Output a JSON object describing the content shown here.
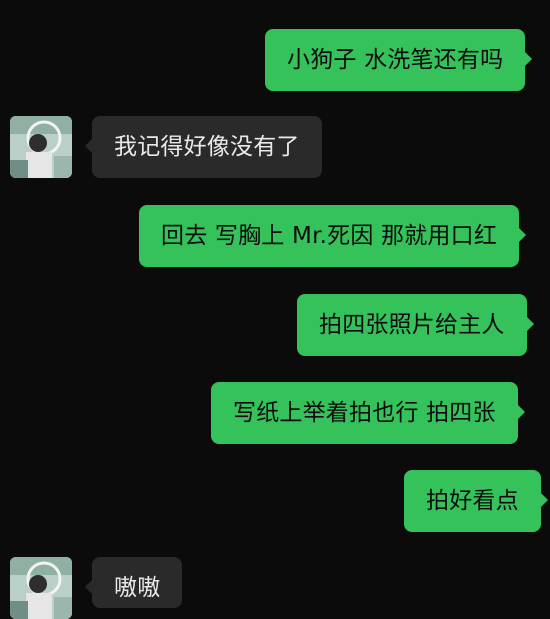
{
  "messages": [
    {
      "sender": "self",
      "text": "小狗子 水洗笔还有吗"
    },
    {
      "sender": "other",
      "text": "我记得好像没有了"
    },
    {
      "sender": "self",
      "text": "回去 写胸上 Mr.死因 那就用口红"
    },
    {
      "sender": "self",
      "text": "拍四张照片给主人"
    },
    {
      "sender": "self",
      "text": "写纸上举着拍也行 拍四张"
    },
    {
      "sender": "self",
      "text": "拍好看点"
    },
    {
      "sender": "other",
      "text": "嗷嗷"
    }
  ],
  "colors": {
    "background": "#0b0b0b",
    "outgoing_bubble": "#35c25b",
    "incoming_bubble": "#2a2a2a",
    "outgoing_text": "#0c0c0c",
    "incoming_text": "#e9e9e9"
  },
  "icons": {
    "contact_avatar": "avatar-photo"
  }
}
